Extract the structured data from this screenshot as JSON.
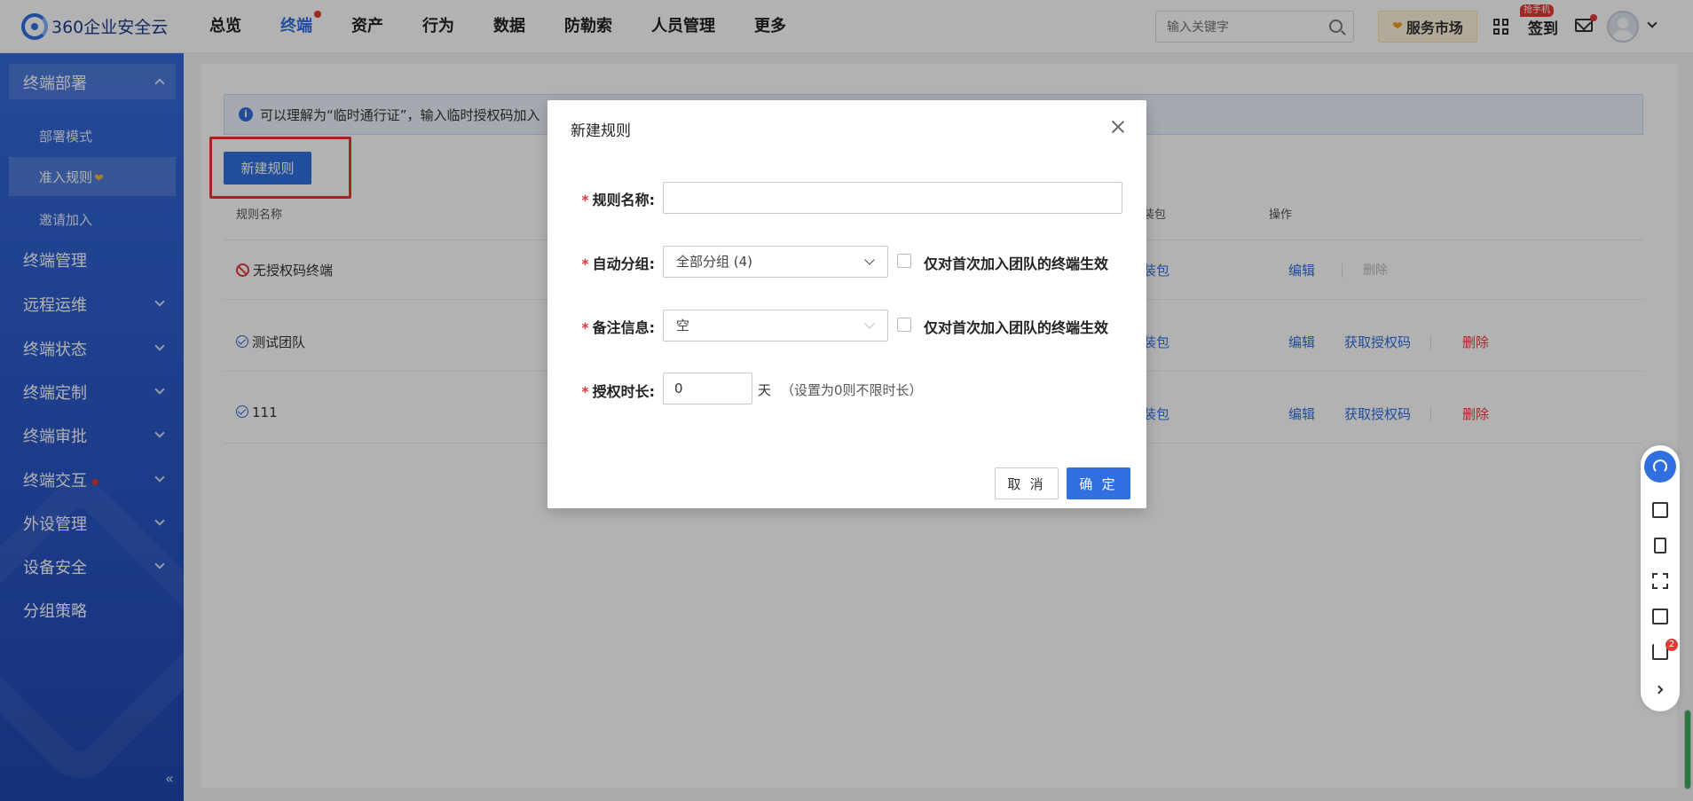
{
  "app": {
    "logo_text": "360企业安全云"
  },
  "nav": {
    "items": [
      {
        "label": "总览"
      },
      {
        "label": "终端",
        "active": true,
        "dot": true
      },
      {
        "label": "资产"
      },
      {
        "label": "行为"
      },
      {
        "label": "数据"
      },
      {
        "label": "防勒索"
      },
      {
        "label": "人员管理"
      },
      {
        "label": "更多"
      }
    ]
  },
  "header": {
    "search_placeholder": "输入关键字",
    "market_label": "服务市场",
    "signin_label": "签到",
    "grab_badge": "抢手机"
  },
  "sidebar": {
    "group_title": "终端部署",
    "sub_items": [
      "部署模式",
      "准入规则",
      "邀请加入"
    ],
    "items": [
      "终端管理",
      "远程运维",
      "终端状态",
      "终端定制",
      "终端审批",
      "终端交互",
      "外设管理",
      "设备安全",
      "分组策略"
    ],
    "collapse_icon": "«"
  },
  "main": {
    "info_text": "可以理解为“临时通行证”，输入临时授权码加入",
    "new_rule_button": "新建规则",
    "columns": {
      "name": "规则名称",
      "pkg": "装包",
      "ops": "操作"
    },
    "rows": [
      {
        "name": "无授权码终端",
        "status": "ban",
        "pkg": "装包",
        "edit": "编辑",
        "get_code": "",
        "delete": "删除",
        "delete_disabled": true
      },
      {
        "name": "测试团队",
        "status": "ok",
        "pkg": "装包",
        "edit": "编辑",
        "get_code": "获取授权码",
        "delete": "删除",
        "delete_disabled": false
      },
      {
        "name": "111",
        "status": "ok",
        "pkg": "装包",
        "edit": "编辑",
        "get_code": "获取授权码",
        "delete": "删除",
        "delete_disabled": false
      }
    ]
  },
  "float_bar": {
    "cart_badge": "2"
  },
  "modal": {
    "title": "新建规则",
    "fields": {
      "name_label": "规则名称:",
      "name_value": "",
      "group_label": "自动分组:",
      "group_value": "全部分组 (4)",
      "group_check_label": "仅对首次加入团队的终端生效",
      "remark_label": "备注信息:",
      "remark_value": "空",
      "remark_check_label": "仅对首次加入团队的终端生效",
      "duration_label": "授权时长:",
      "duration_value": "0",
      "duration_unit": "天",
      "duration_hint": "（设置为0则不限时长）"
    },
    "cancel_label": "取 消",
    "ok_label": "确 定"
  },
  "colors": {
    "accent": "#2f6fe0",
    "danger": "#e53935",
    "sidebar": "#2f5fcf"
  }
}
